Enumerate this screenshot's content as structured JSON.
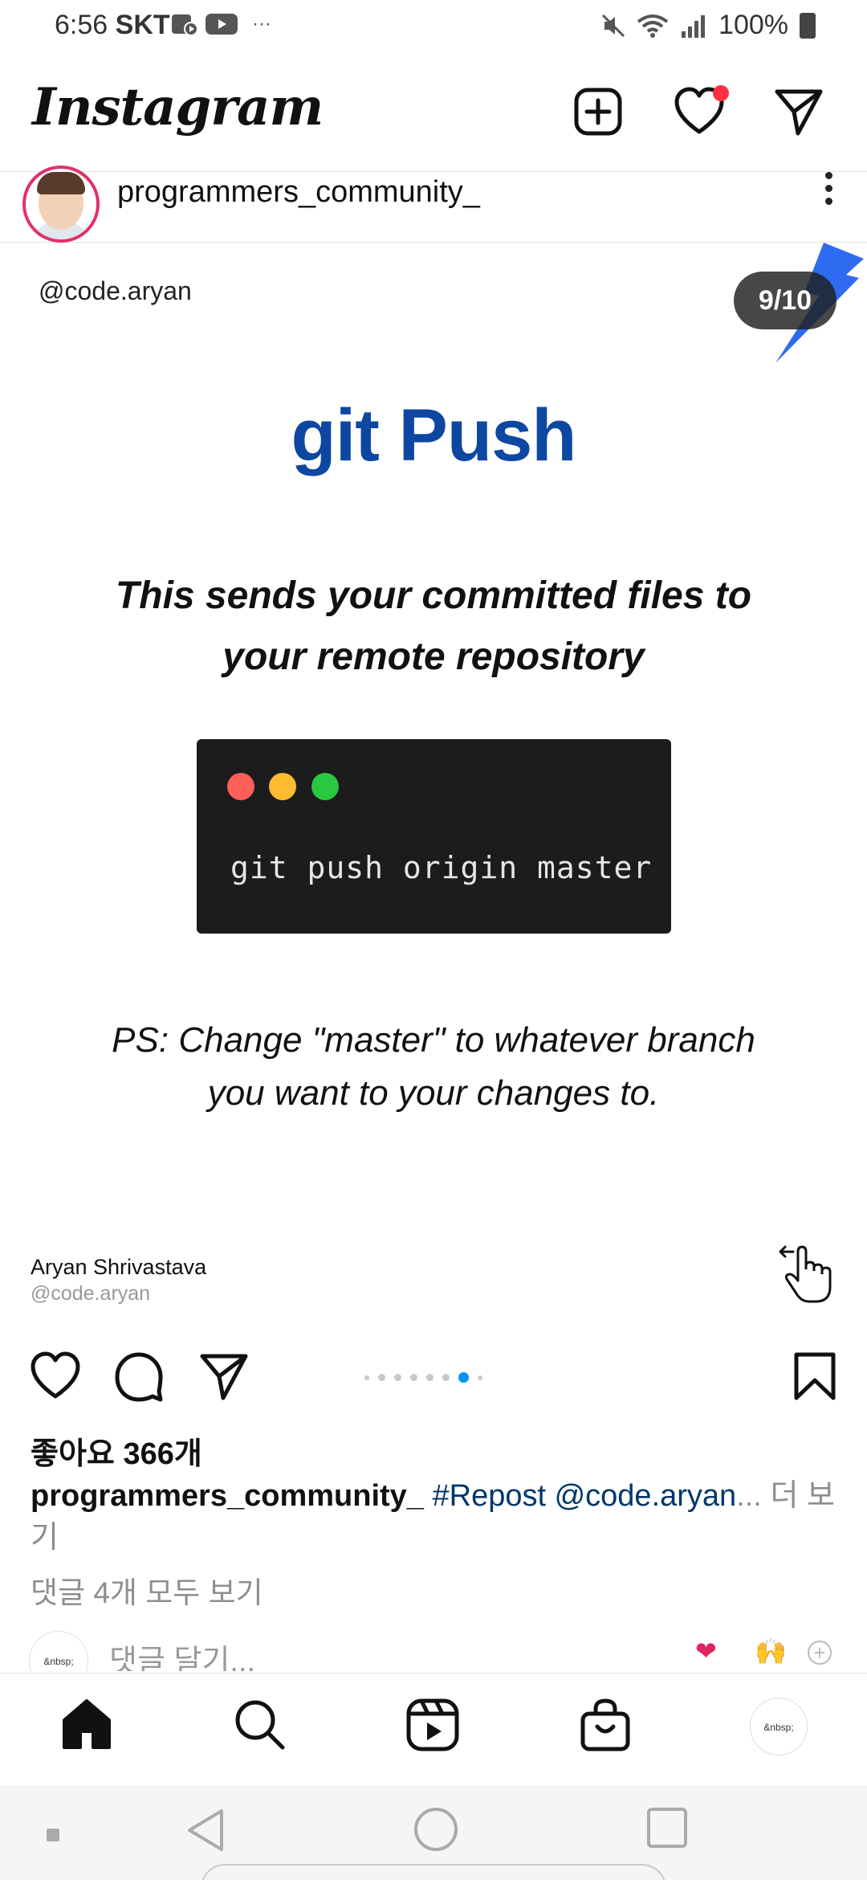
{
  "status_bar": {
    "time": "6:56",
    "carrier": "SKT",
    "overflow": "···",
    "battery": "100%",
    "icons": [
      "screen-record-icon",
      "youtube-icon",
      "mute-icon",
      "wifi-icon",
      "signal-icon",
      "battery-icon"
    ]
  },
  "header": {
    "logo": "Instagram",
    "icons": [
      "create-post-icon",
      "heart-icon",
      "direct-message-icon"
    ]
  },
  "post": {
    "username": "programmers_community_",
    "slide": {
      "handle": "@code.aryan",
      "counter": "9/10",
      "title": "git Push",
      "description": "This sends your committed files to your remote repository",
      "command": "git push origin master",
      "note": "PS: Change \"master\" to whatever branch you want to your changes to.",
      "author_name": "Aryan Shrivastava",
      "author_handle": "@code.aryan"
    },
    "likes": "좋아요 366개",
    "caption": {
      "user": "programmers_community_",
      "text": "#Repost @code.aryan",
      "ellipsis": "...",
      "more": "더 보기"
    },
    "view_comments": "댓글 4개 모두 보기",
    "comment_placeholder": "댓글 달기...",
    "my_avatar_text": "&nbsp;",
    "quick_emojis": [
      "❤",
      "🙌",
      "+"
    ]
  },
  "carousel": {
    "total_dots": 8,
    "active_index": 6
  },
  "bottom_nav": {
    "items": [
      "home-icon",
      "search-icon",
      "reels-icon",
      "shop-icon",
      "profile-avatar"
    ],
    "profile_text": "&nbsp;"
  },
  "colors": {
    "title_blue": "#0d47a1",
    "active_dot": "#0095f6",
    "notification": "#ff3040",
    "hashtag": "#00376b"
  }
}
